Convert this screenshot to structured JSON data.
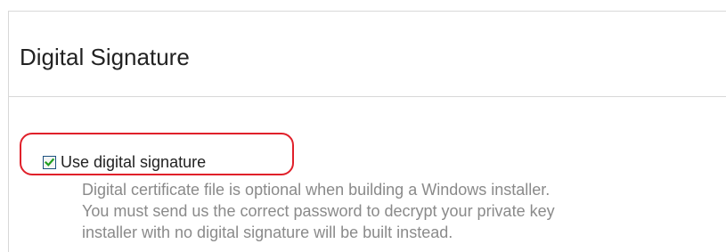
{
  "panel": {
    "title": "Digital Signature"
  },
  "option": {
    "label": "Use digital signature",
    "checked": true,
    "highlight_color": "#e0202a",
    "check_color": "#1e9e1e"
  },
  "description": {
    "lines": [
      "Digital certificate file is optional when building a Windows installer.",
      "You must send us the correct password to decrypt your private key",
      "installer with no digital signature will be built instead."
    ]
  }
}
